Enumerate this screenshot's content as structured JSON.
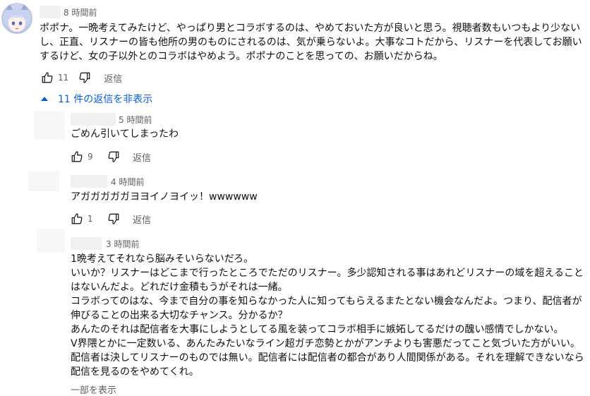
{
  "comments": {
    "top": {
      "timestamp": "8 時間前",
      "text": "ポポナ。一晩考えてみたけど、やっぱり男とコラボするのは、やめておいた方が良いと思う。視聴者数もいつもより少ないし、正直、リスナーの皆も他所の男のものにされるのは、気が乗らないよ。大事なコトだから、リスナーを代表してお願いするけど、女の子以外とのコラボはやめよう。ポポナのことを思っての、お願いだからね。",
      "likes": "11",
      "reply_label": "返信",
      "toggle_label": "11 件の返信を非表示"
    },
    "replies": [
      {
        "timestamp": "5 時間前",
        "text": "ごめん引いてしまったわ",
        "likes": "9",
        "reply_label": "返信"
      },
      {
        "timestamp": "4 時間前",
        "text": "アガガガガガヨヨイノヨイッ！wwwwww",
        "likes": "1",
        "reply_label": "返信"
      },
      {
        "timestamp": "3 時間前",
        "text": "1晩考えてそれなら脳みそいらないだろ。\nいいか？リスナーはどこまで行ったところでただのリスナー。多少認知される事はあれどリスナーの域を超えることはないんだよ。どれだけ金積もうがそれは一緒。\nコラボってのはな、今まで自分の事を知らなかった人に知ってもらえるまたとない機会なんだよ。つまり、配信者が伸びることの出来る大切なチャンス。分かるか？\nあんたのそれは配信者を大事にしようとしてる風を装ってコラボ相手に嫉妬してるだけの醜い感情でしかない。\nV界隈とかに一定数いる、あんたみたいなライン超ガチ恋勢とかがアンチよりも害悪だってこと気づいた方がいい。\n配信者は決してリスナーのものでは無い。配信者には配信者の都合があり人間関係がある。それを理解できないなら配信を見るのをやめてくれ。",
        "show_more_label": "一部を表示"
      }
    ]
  }
}
